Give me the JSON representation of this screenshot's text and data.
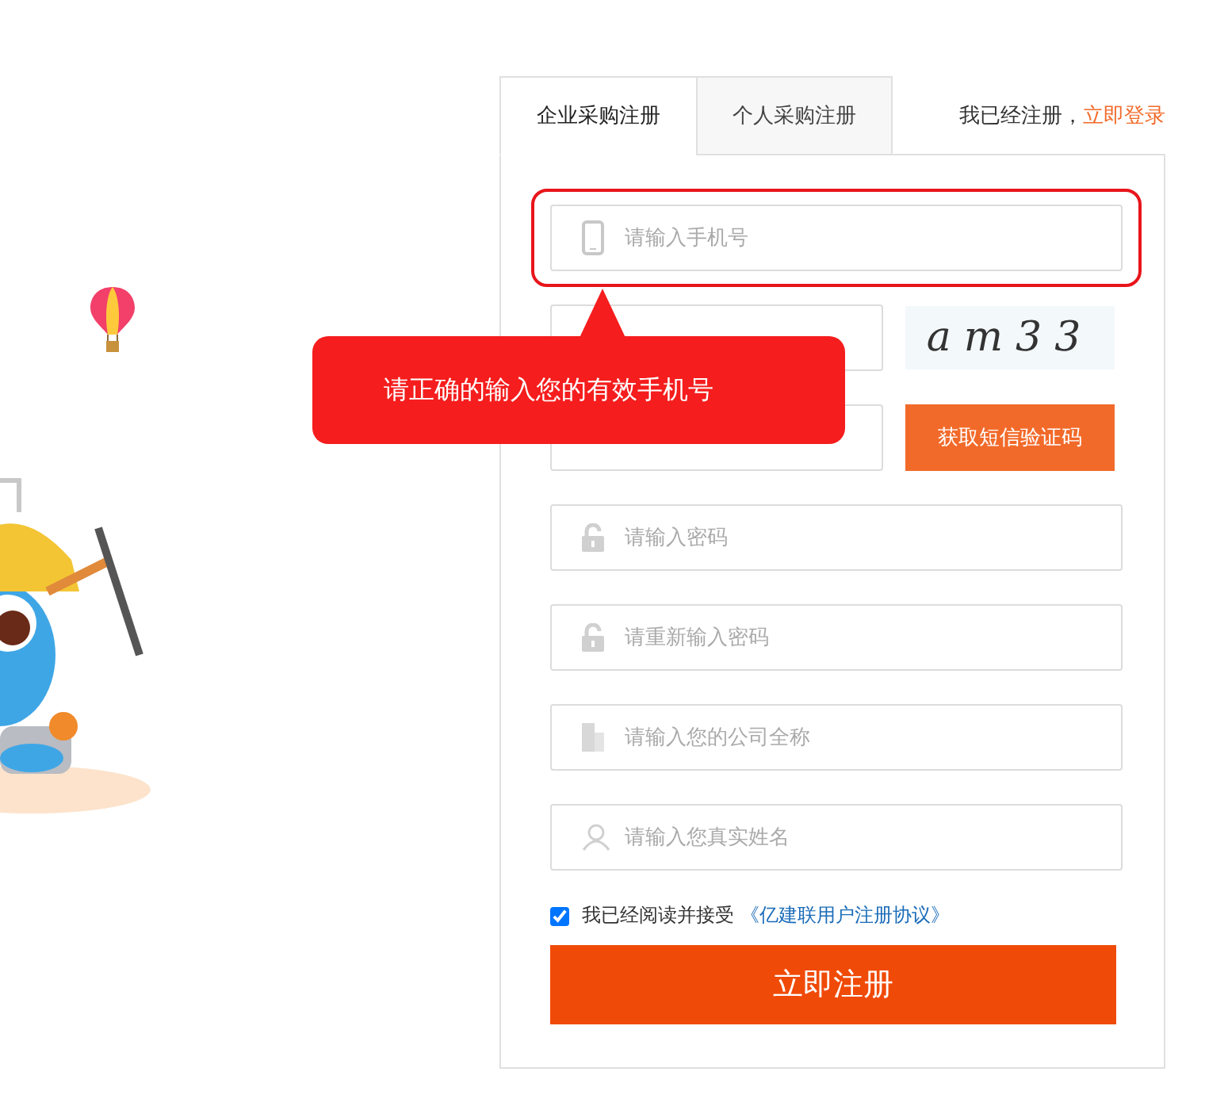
{
  "tabs": [
    {
      "label": "企业采购注册",
      "selected": true
    },
    {
      "label": "个人采购注册",
      "selected": false
    }
  ],
  "login_prompt": {
    "text": "我已经注册，",
    "link": "立即登录"
  },
  "fields": [
    {
      "kind": "phone",
      "placeholder": "请输入手机号",
      "error": true
    },
    {
      "kind": "captcha",
      "captcha": "am33",
      "error": false
    },
    {
      "kind": "sms",
      "button": "获取短信验证码",
      "error": false
    },
    {
      "kind": "password",
      "placeholder": "请输入密码",
      "error": false
    },
    {
      "kind": "password",
      "placeholder": "请重新输入密码",
      "error": false
    },
    {
      "kind": "company",
      "placeholder": "请输入您的公司全称",
      "error": false
    },
    {
      "kind": "person",
      "placeholder": "请输入您真实姓名",
      "error": false
    }
  ],
  "error_tooltip": "请正确的输入您的有效手机号",
  "agreement": {
    "checked": true,
    "text": "我已经阅读并接受",
    "link": "《亿建联用户注册协议》"
  },
  "submit": "立即注册"
}
